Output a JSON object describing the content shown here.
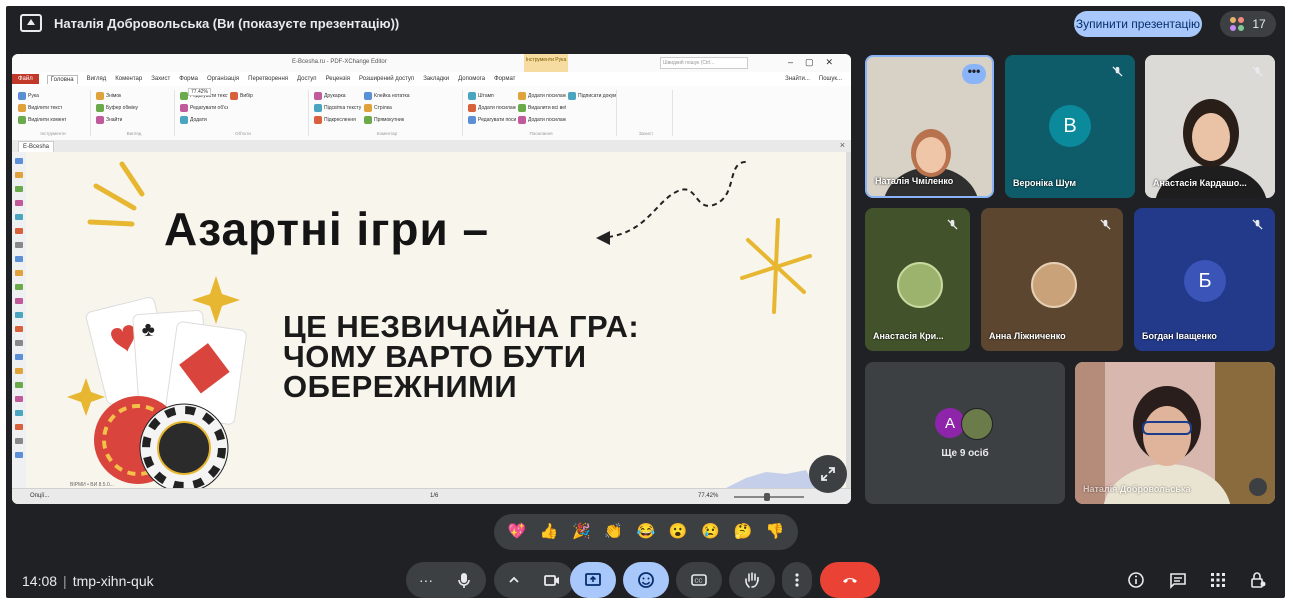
{
  "topbar": {
    "presenter_label": "Наталія Добровольська (Ви (показуєте презентацію))",
    "stop_button": "Зупинити презентацію",
    "participant_count": "17"
  },
  "shared_window": {
    "title": "E-Bcesha.ru - PDF-XChange Editor",
    "search_placeholder": "Швидкий пошук (Ctrl...",
    "tools_badge": "Інструменти Рука",
    "menu": [
      "Файл",
      "Головна",
      "Вигляд",
      "Коментар",
      "Захист",
      "Форма",
      "Організація",
      "Перетворення",
      "Доступ",
      "Рецензія",
      "Розширений доступ",
      "Закладки",
      "Допомога",
      "Формат"
    ],
    "menu_right": [
      "Знайти...",
      "Пошук..."
    ],
    "ribbon_groups": [
      "Інструменти",
      "Вигляд",
      "Об'єкти",
      "Коментар",
      "Посилання",
      "Захист"
    ],
    "ribbon_items": [
      "Рука",
      "Виділити текст",
      "Виділити коментарі",
      "Знімок",
      "Буфер обміну",
      "Знайти",
      "Редагувати текст",
      "Редагувати об'єкти",
      "Додати",
      "Вибір",
      "Друкарка",
      "Підсвітка тексту",
      "Підкреслення",
      "Клейка нотатка",
      "Стрілка",
      "Прямокутник",
      "Штамп",
      "Додати посилання",
      "Редагувати посилання",
      "Додати посилання до URL-адрес",
      "Видалити всі веб-посилання",
      "Додати посилання до штрих-коду",
      "Підписати документ"
    ],
    "zoom_value": "77.42%",
    "doc_tab": "E-Bcesha",
    "status_left": "Опції...",
    "page_indicator": "1/6",
    "status_zoom": "77.42%"
  },
  "slide": {
    "title": "Азартні ігри –",
    "subtitle_lines": [
      "ЦЕ НЕЗВИЧАЙНА ГРА:",
      "ЧОМУ ВАРТО БУТИ",
      "ОБЕРЕЖНИМИ"
    ],
    "footer_text": "ВІРМИ • ВИ 8.5.0..."
  },
  "participants": [
    {
      "name": "Наталія Чміленко",
      "type": "video"
    },
    {
      "name": "Вероніка Шум",
      "initial": "В",
      "avatar_color": "#0b8a9b",
      "type": "avatar"
    },
    {
      "name": "Анастасія Кардашо...",
      "type": "video"
    },
    {
      "name": "Анастасія Кри...",
      "type": "video"
    },
    {
      "name": "Анна Ліжниченко",
      "type": "video"
    },
    {
      "name": "Богдан Іващенко",
      "initial": "Б",
      "avatar_color": "#3b54b8",
      "type": "avatar"
    },
    {
      "name": "Ще 9 осіб",
      "initial": "A",
      "avatar_color": "#8e24aa",
      "type": "more"
    },
    {
      "name": "Наталія Добровольська",
      "type": "video"
    }
  ],
  "reactions": [
    "💖",
    "👍",
    "🎉",
    "👏",
    "😂",
    "😮",
    "😢",
    "🤔",
    "👎"
  ],
  "bottombar": {
    "time": "14:08",
    "meeting_code": "tmp-xihn-quk"
  },
  "colors": {
    "background": "#202124",
    "tile": "#3c4043",
    "accent": "#a8c7fa",
    "hangup": "#ea4335"
  }
}
